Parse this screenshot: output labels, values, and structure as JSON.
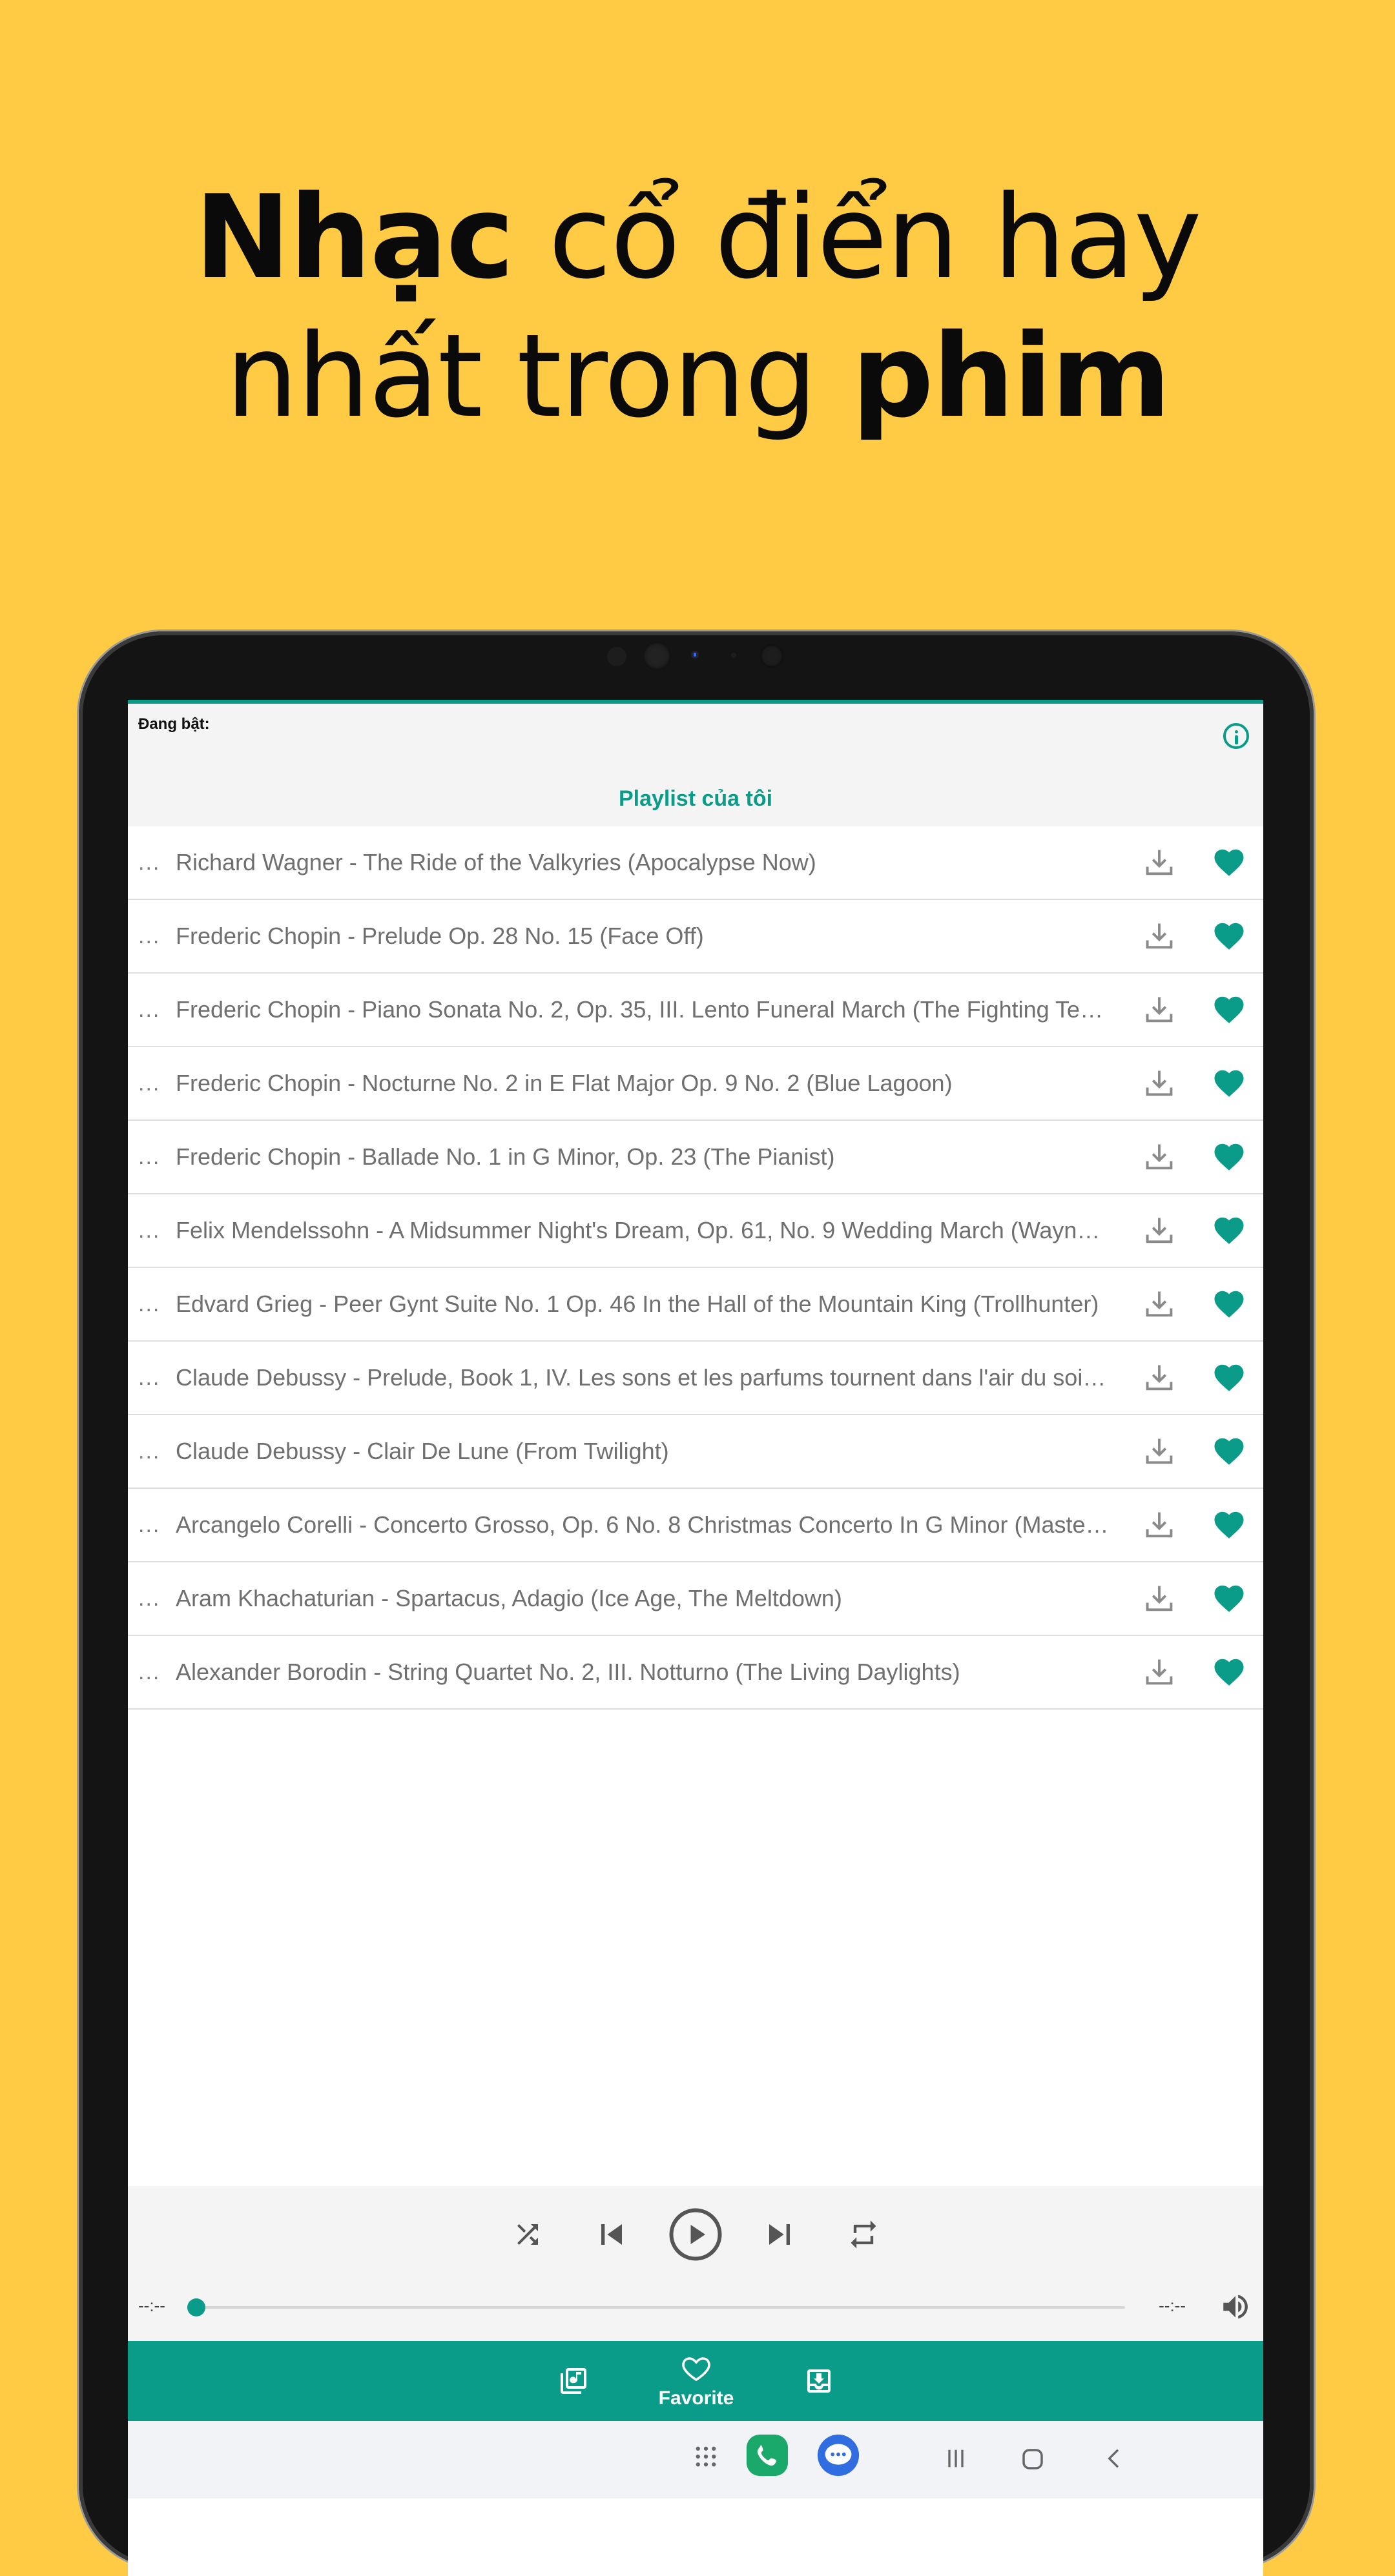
{
  "headline": {
    "line1_bold": "Nhạc",
    "line1_rest": " cổ điển hay",
    "line2_start": "nhất trong ",
    "line2_bold": "phim"
  },
  "app": {
    "now_playing_label": "Đang bật:",
    "playlist_title": "Playlist của tôi",
    "accent_color": "#0A9B89",
    "background_color": "#FFCB45",
    "row_prefix": "...",
    "tracks": [
      "Richard Wagner - The Ride of the Valkyries (Apocalypse Now)",
      "Frederic Chopin - Prelude Op. 28 No. 15 (Face Off)",
      "Frederic Chopin - Piano Sonata No. 2, Op. 35, III. Lento Funeral March (The Fighting Tempt..",
      "Frederic Chopin - Nocturne No. 2 in E Flat Major Op. 9 No. 2 (Blue Lagoon)",
      "Frederic Chopin - Ballade No. 1 in G Minor, Op. 23 (The Pianist)",
      "Felix Mendelssohn - A Midsummer Night's Dream, Op. 61, No. 9 Wedding March (Wayne's..",
      "Edvard Grieg - Peer Gynt Suite No. 1 Op. 46 In the Hall of the Mountain King (Trollhunter)",
      "Claude Debussy - Prelude, Book 1, IV. Les sons et les parfums tournent dans l'air du soir (T..",
      "Claude Debussy - Clair De Lune (From Twilight)",
      "Arcangelo Corelli - Concerto Grosso, Op. 6 No. 8 Christmas Concerto In G Minor (Master an..",
      "Aram Khachaturian - Spartacus, Adagio (Ice Age, The Meltdown)",
      "Alexander Borodin - String Quartet No. 2, III. Notturno (The Living Daylights)"
    ],
    "player": {
      "time_elapsed": "--:--",
      "time_total": "--:--",
      "progress": 0
    },
    "tabs": {
      "favorite_label": "Favorite"
    },
    "icons": {
      "info": "info-icon",
      "download": "download-icon",
      "favorite": "heart-icon",
      "shuffle": "shuffle-icon",
      "previous": "skip-previous-icon",
      "play": "play-icon",
      "next": "skip-next-icon",
      "repeat": "repeat-icon",
      "volume": "volume-icon"
    }
  }
}
